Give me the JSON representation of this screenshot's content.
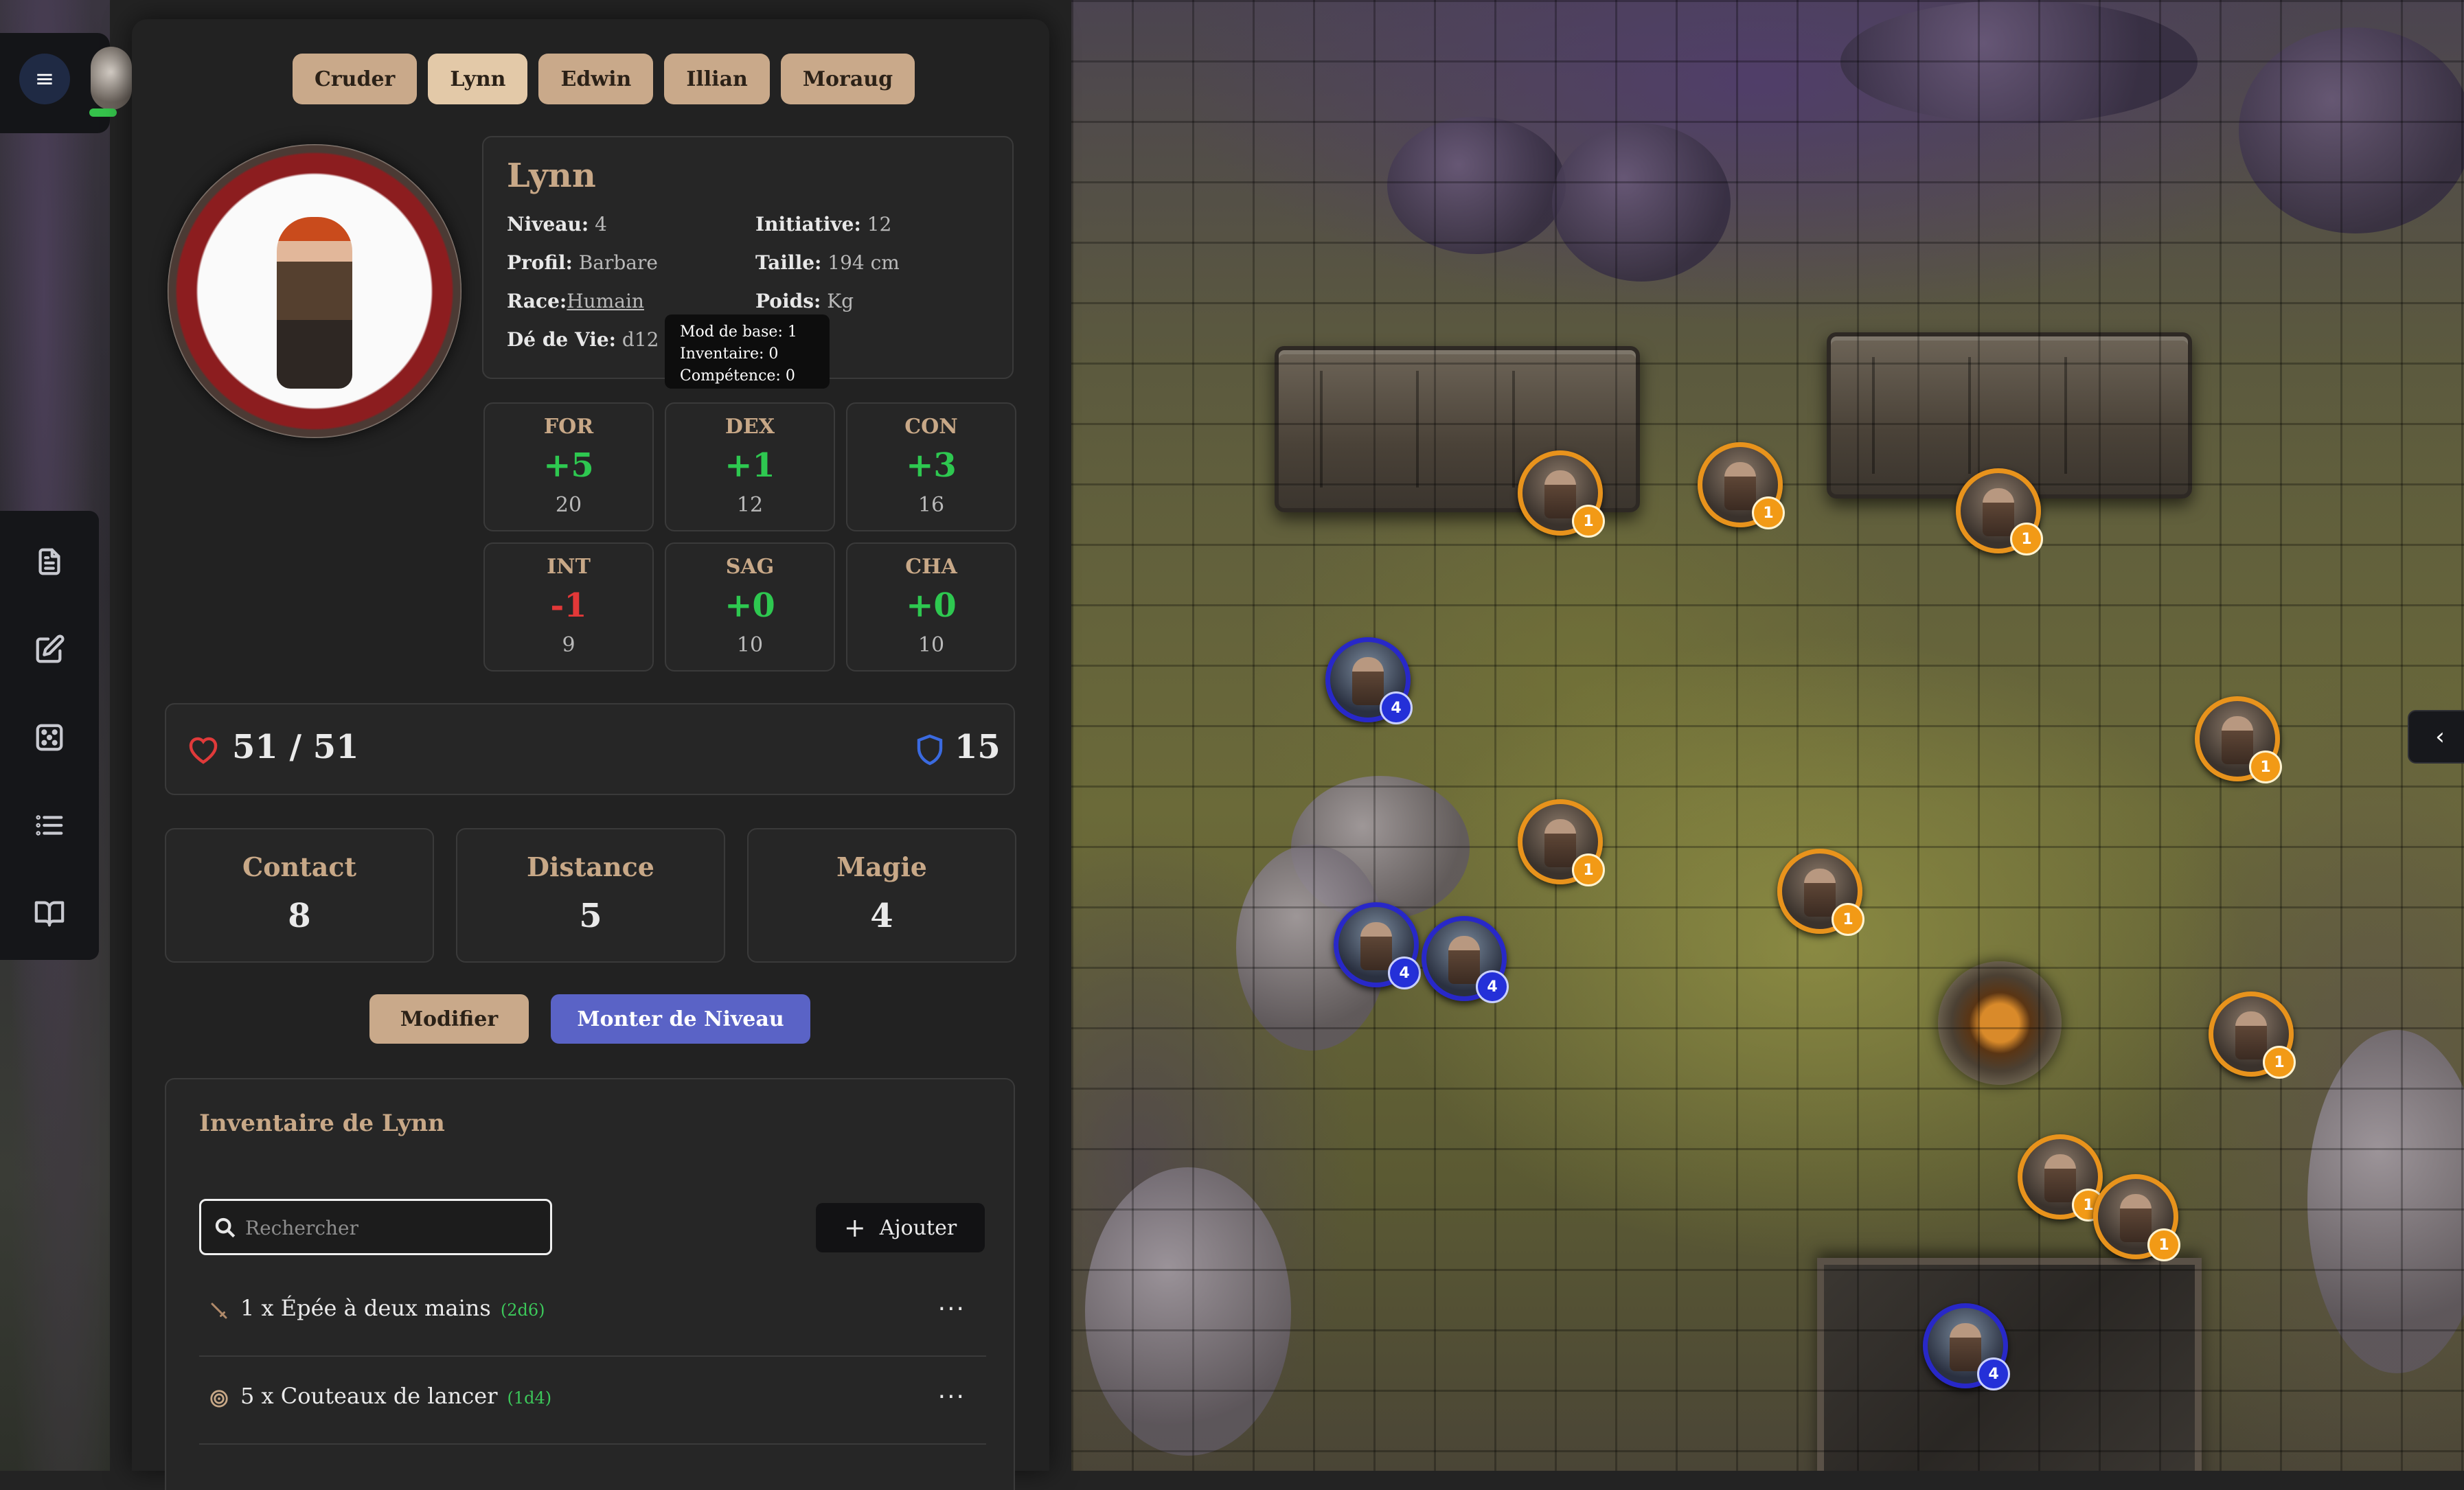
{
  "menu": {
    "icon": "hamburger-icon",
    "health_color": "#35c24b"
  },
  "toolbar": {
    "items": [
      {
        "name": "character-sheet",
        "icon": "document-icon"
      },
      {
        "name": "edit",
        "icon": "edit-icon"
      },
      {
        "name": "dice",
        "icon": "dice-icon"
      },
      {
        "name": "list",
        "icon": "list-icon"
      },
      {
        "name": "rules",
        "icon": "book-icon"
      }
    ]
  },
  "tabs": [
    "Cruder",
    "Lynn",
    "Edwin",
    "Illian",
    "Moraug"
  ],
  "active_tab": "Lynn",
  "character": {
    "name": "Lynn",
    "level_label": "Niveau:",
    "level": "4",
    "profile_label": "Profil:",
    "profile": "Barbare",
    "race_label": "Race:",
    "race": "Humain",
    "hit_die_label": "Dé de Vie:",
    "hit_die": "d12",
    "initiative_label": "Initiative:",
    "initiative": "12",
    "height_label": "Taille:",
    "height": "194 cm",
    "weight_label": "Poids:",
    "weight": "Kg"
  },
  "tooltip": {
    "line1": "Mod de base: 1",
    "line2": "Inventaire: 0",
    "line3": "Compétence: 0"
  },
  "stats": [
    {
      "name": "FOR",
      "mod": "+5",
      "value": "20"
    },
    {
      "name": "DEX",
      "mod": "+1",
      "value": "12"
    },
    {
      "name": "CON",
      "mod": "+3",
      "value": "16"
    },
    {
      "name": "INT",
      "mod": "-1",
      "value": "9"
    },
    {
      "name": "SAG",
      "mod": "+0",
      "value": "10"
    },
    {
      "name": "CHA",
      "mod": "+0",
      "value": "10"
    }
  ],
  "vitals": {
    "hp": "51 / 51",
    "ac": "15",
    "hp_color": "#e03a3a",
    "ac_color": "#3a6ae0"
  },
  "attacks": [
    {
      "name": "Contact",
      "value": "8"
    },
    {
      "name": "Distance",
      "value": "5"
    },
    {
      "name": "Magie",
      "value": "4"
    }
  ],
  "buttons": {
    "modify": "Modifier",
    "level_up": "Monter de Niveau"
  },
  "inventory": {
    "title": "Inventaire de Lynn",
    "search_placeholder": "Rechercher",
    "search_value": "",
    "add_label": "Ajouter",
    "items": [
      {
        "text": "1 x Épée à deux mains",
        "damage": "(2d6)",
        "icon": "sword-icon",
        "more": "..."
      },
      {
        "text": "5 x Couteaux de lancer",
        "damage": "(1d4)",
        "icon": "target-icon",
        "more": "..."
      }
    ]
  },
  "map": {
    "tokens": [
      {
        "kind": "enemy",
        "badge": "1"
      },
      {
        "kind": "enemy",
        "badge": "1"
      },
      {
        "kind": "enemy",
        "badge": "1"
      },
      {
        "kind": "ally",
        "badge": "4"
      },
      {
        "kind": "enemy",
        "badge": "1"
      },
      {
        "kind": "enemy",
        "badge": "1"
      },
      {
        "kind": "enemy",
        "badge": "1"
      },
      {
        "kind": "ally",
        "badge": "4"
      },
      {
        "kind": "ally",
        "badge": "4"
      },
      {
        "kind": "enemy",
        "badge": "1"
      },
      {
        "kind": "enemy",
        "badge": "1"
      },
      {
        "kind": "enemy",
        "badge": "1"
      },
      {
        "kind": "ally",
        "badge": "4"
      }
    ],
    "collapse_icon": "chevron-left-icon"
  }
}
